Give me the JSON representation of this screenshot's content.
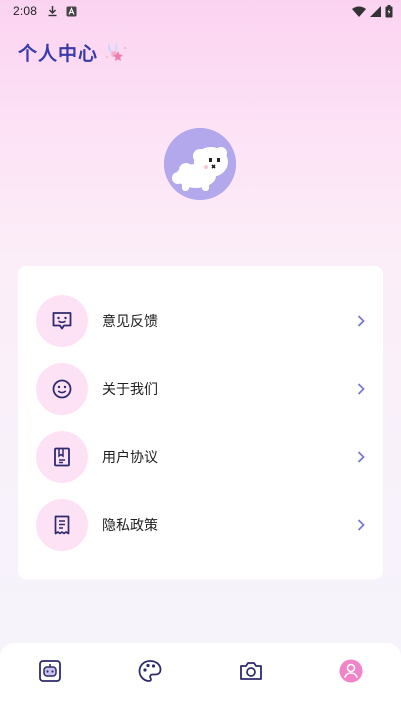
{
  "status_bar": {
    "time": "2:08",
    "icons": [
      "download-icon",
      "a-notification-icon",
      "wifi-icon",
      "signal-icon",
      "battery-icon"
    ]
  },
  "header": {
    "title": "个人中心",
    "decoration_icon": "fairy-sparkle-icon"
  },
  "profile": {
    "avatar_icon": "white-puppy-avatar",
    "avatar_bg": "#b3a8ec"
  },
  "menu": {
    "items": [
      {
        "label": "意见反馈",
        "icon": "feedback-message-icon"
      },
      {
        "label": "关于我们",
        "icon": "smiley-face-icon"
      },
      {
        "label": "用户协议",
        "icon": "agreement-book-icon"
      },
      {
        "label": "隐私政策",
        "icon": "privacy-document-icon"
      }
    ],
    "chevron_icon": "chevron-right-icon"
  },
  "tab_bar": {
    "tabs": [
      {
        "icon": "robot-home-icon",
        "active": false
      },
      {
        "icon": "palette-icon",
        "active": false
      },
      {
        "icon": "camera-icon",
        "active": false
      },
      {
        "icon": "profile-user-icon",
        "active": true
      }
    ]
  },
  "colors": {
    "accent": "#3a3aa8",
    "icon_stroke": "#2e2a6e",
    "chevron": "#7b78d4",
    "active_tab": "#f084c8",
    "icon_circle": "#fde2f6"
  }
}
